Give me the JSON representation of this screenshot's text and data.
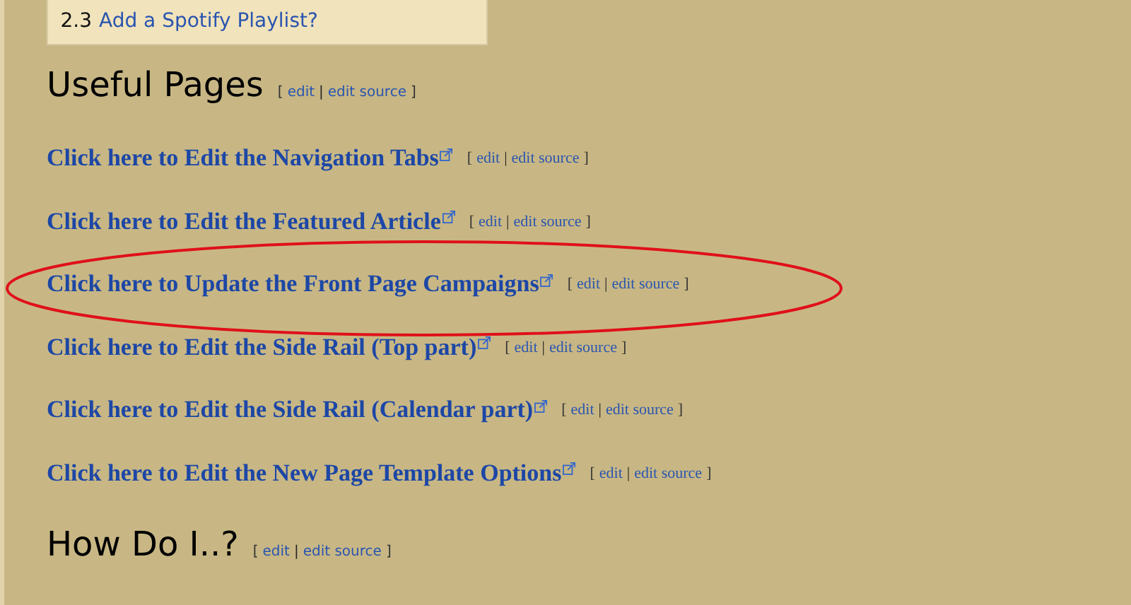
{
  "toc": [
    {
      "number": "2.3",
      "label": "Add a Spotify Playlist?"
    }
  ],
  "edit_brackets": {
    "open": "[",
    "separator": "|",
    "close": "]"
  },
  "sections": [
    {
      "heading": "Useful Pages",
      "edit": "edit",
      "edit_source": "edit source",
      "links": [
        {
          "label": "Click here to Edit the Navigation Tabs",
          "edit": "edit",
          "edit_source": "edit source",
          "highlighted": false
        },
        {
          "label": "Click here to Edit the Featured Article",
          "edit": "edit",
          "edit_source": "edit source",
          "highlighted": false
        },
        {
          "label": "Click here to Update the Front Page Campaigns",
          "edit": "edit",
          "edit_source": "edit source",
          "highlighted": true
        },
        {
          "label": "Click here to Edit the Side Rail (Top part)",
          "edit": "edit",
          "edit_source": "edit source",
          "highlighted": false
        },
        {
          "label": "Click here to Edit the Side Rail (Calendar part)",
          "edit": "edit",
          "edit_source": "edit source",
          "highlighted": false
        },
        {
          "label": "Click here to Edit the New Page Template Options",
          "edit": "edit",
          "edit_source": "edit source",
          "highlighted": false
        }
      ]
    },
    {
      "heading": "How Do I..?",
      "edit": "edit",
      "edit_source": "edit source"
    }
  ]
}
